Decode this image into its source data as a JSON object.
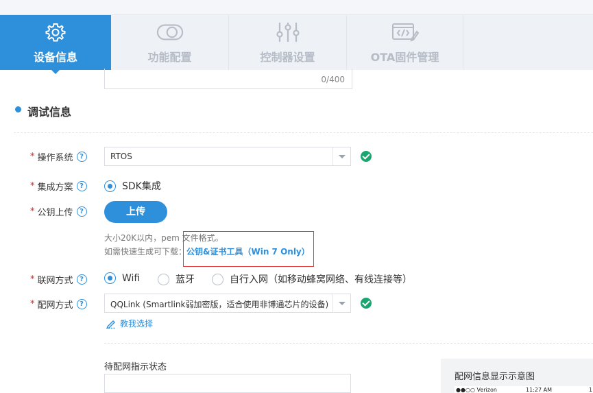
{
  "tabs": [
    {
      "label": "设备信息",
      "icon": "gear-icon",
      "active": true
    },
    {
      "label": "功能配置",
      "icon": "toggle-icon",
      "active": false
    },
    {
      "label": "控制器设置",
      "icon": "sliders-icon",
      "active": false
    },
    {
      "label": "OTA固件管理",
      "icon": "code-edit-icon",
      "active": false
    }
  ],
  "counter": "0/400",
  "section": {
    "title": "调试信息"
  },
  "form": {
    "os": {
      "label": "操作系统",
      "value": "RTOS"
    },
    "integration": {
      "label": "集成方案",
      "option": "SDK集成"
    },
    "pubkey": {
      "label": "公钥上传",
      "button": "上传",
      "hint1": "大小20K以内，pem 文件格式。",
      "hint2": "如需快速生成可下载：",
      "link": "公钥&证书工具（Win 7 Only）"
    },
    "network": {
      "label": "联网方式",
      "options": [
        "Wifi",
        "蓝牙",
        "自行入网（如移动蜂窝网络、有线连接等）"
      ],
      "selected": "Wifi"
    },
    "provision": {
      "label": "配网方式",
      "value": "QQLink (Smartlink弱加密版，适合使用非博通芯片的设备)",
      "teach": "教我选择"
    },
    "indicator": {
      "label": "待配网指示状态"
    }
  },
  "preview": {
    "title": "配网信息显示示意图",
    "carrier": "●●○○ Verizon",
    "time": "11:27 AM",
    "extra": "1"
  },
  "colors": {
    "accent": "#2e8fdb",
    "success": "#1aa66f",
    "required": "#e02020",
    "highlight": "#e03a3a"
  }
}
